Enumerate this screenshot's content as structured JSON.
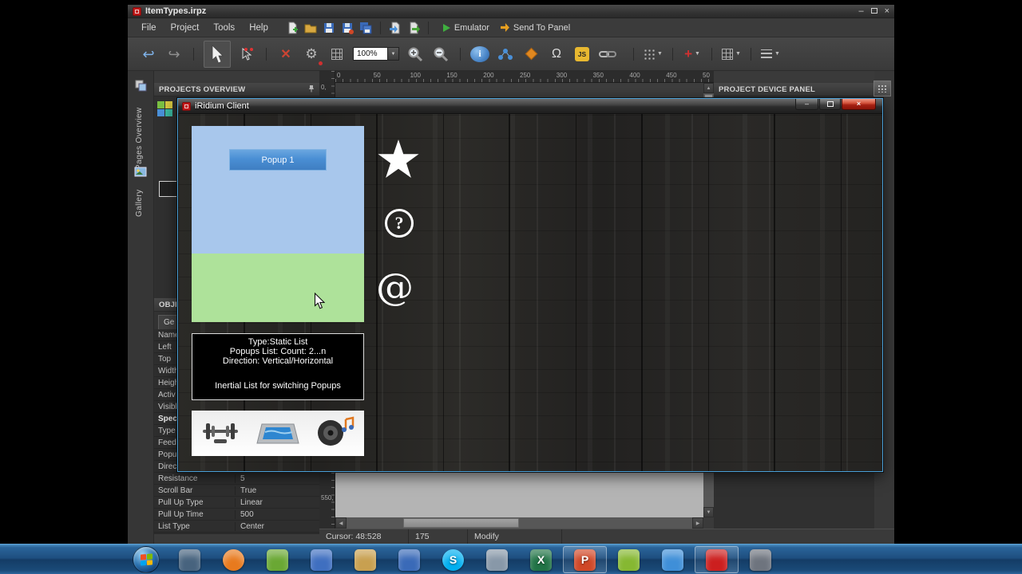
{
  "titlebar": {
    "title": "ItemTypes.irpz"
  },
  "icons": {
    "minimize": "–",
    "close": "×"
  },
  "menubar": {
    "items": [
      "File",
      "Project",
      "Tools",
      "Help"
    ],
    "emulator_label": "Emulator",
    "send_to_panel_label": "Send To Panel"
  },
  "toolbar": {
    "zoom_value": "100%",
    "omega_label": "Ω",
    "js_label": "JS"
  },
  "ruler": {
    "h_marks": [
      "0",
      "50",
      "100",
      "150",
      "200",
      "250",
      "300",
      "350",
      "400",
      "450",
      "50"
    ],
    "v_top": "0,",
    "v_bottom": "550,"
  },
  "left_tabs": {
    "pages_overview": "Pages Overview",
    "gallery": "Gallery"
  },
  "projects_panel": {
    "header": "PROJECTS OVERVIEW"
  },
  "device_panel": {
    "header": "PROJECT DEVICE PANEL"
  },
  "properties_panel": {
    "header": "OBJE",
    "tab": "Ge",
    "rows": [
      {
        "label": "Name",
        "value": ""
      },
      {
        "label": "Left",
        "value": ""
      },
      {
        "label": "Top",
        "value": ""
      },
      {
        "label": "Width",
        "value": ""
      },
      {
        "label": "Heigh",
        "value": ""
      },
      {
        "label": "Activ",
        "value": ""
      },
      {
        "label": "Visibl",
        "value": ""
      },
      {
        "label": "Spec",
        "value": "",
        "bold": true
      },
      {
        "label": "Type",
        "value": ""
      },
      {
        "label": "Feed",
        "value": ""
      },
      {
        "label": "Popu",
        "value": ""
      },
      {
        "label": "Direc",
        "value": ""
      },
      {
        "label": "Resistance",
        "value": "5"
      },
      {
        "label": "Scroll Bar",
        "value": "True"
      },
      {
        "label": "Pull Up Type",
        "value": "Linear"
      },
      {
        "label": "Pull Up Time",
        "value": "500"
      },
      {
        "label": "List Type",
        "value": "Center"
      }
    ]
  },
  "client_window": {
    "title": "iRidium Client",
    "popup_button_label": "Popup 1",
    "question_glyph": "?",
    "at_glyph": "@",
    "info_box": {
      "lines": [
        "Type:Static List",
        "Popups List: Count: 2...n",
        "Direction: Vertical/Horizontal"
      ],
      "caption": "Inertial List for switching Popups"
    }
  },
  "statusbar": {
    "cursor": "Cursor: 48:528",
    "value": "175",
    "mode": "Modify"
  },
  "taskbar": {
    "items": [
      {
        "name": "desktop-viewer",
        "color": "#47637e",
        "letter": "",
        "shape": "square",
        "running": false
      },
      {
        "name": "firefox",
        "color": "#e87a1e",
        "letter": "",
        "shape": "circle",
        "running": false
      },
      {
        "name": "media-green",
        "color": "#6aa834",
        "letter": "",
        "shape": "square",
        "running": false
      },
      {
        "name": "floppy-save",
        "color": "#3f6fc0",
        "letter": "",
        "shape": "square",
        "running": false
      },
      {
        "name": "installer-box",
        "color": "#c8a050",
        "letter": "",
        "shape": "square",
        "running": false
      },
      {
        "name": "blue-tool",
        "color": "#3a6ab8",
        "letter": "",
        "shape": "square",
        "running": false
      },
      {
        "name": "skype",
        "color": "#00aff0",
        "letter": "S",
        "shape": "circle",
        "running": false
      },
      {
        "name": "photo-viewer",
        "color": "#8898a8",
        "letter": "",
        "shape": "square",
        "running": false
      },
      {
        "name": "excel",
        "color": "#217346",
        "letter": "X",
        "shape": "square",
        "running": false
      },
      {
        "name": "powerpoint",
        "color": "#d04727",
        "letter": "P",
        "shape": "square",
        "running": true
      },
      {
        "name": "sticky-notes",
        "color": "#86b832",
        "letter": "",
        "shape": "square",
        "running": false
      },
      {
        "name": "network-places",
        "color": "#3f8fd8",
        "letter": "",
        "shape": "square",
        "running": false
      },
      {
        "name": "iridium-client",
        "color": "#cc1f1f",
        "letter": "",
        "shape": "square",
        "running": true
      },
      {
        "name": "camera-device",
        "color": "#6e747e",
        "letter": "",
        "shape": "square",
        "running": false
      }
    ]
  },
  "colors": {
    "accent_blue": "#4aa0d8",
    "panel_blue": "#a8c7ec",
    "panel_green": "#aee29a",
    "popup_button": "#4a8fd4",
    "close_red": "#c43a2b",
    "canvas_gray": "#b4b4b4",
    "taskbar_blue": "#1e4f80"
  }
}
